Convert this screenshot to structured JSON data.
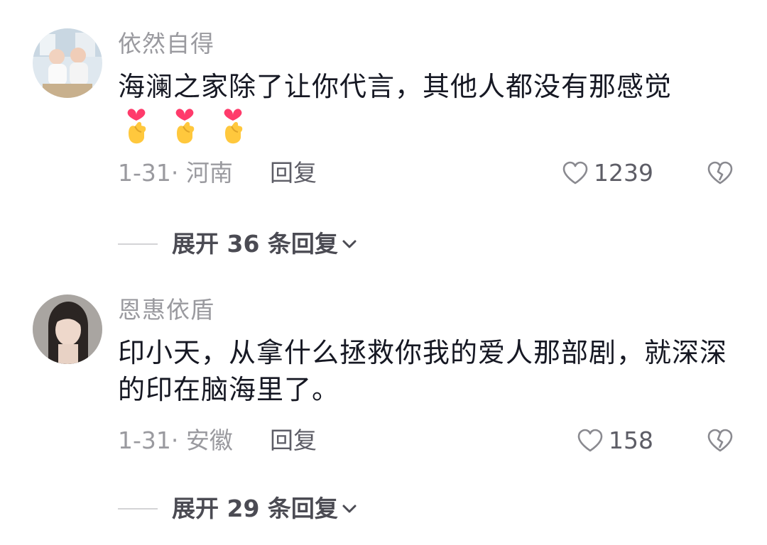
{
  "comments": [
    {
      "username": "依然自得",
      "text": "海澜之家除了让你代言，其他人都没有那感觉",
      "emoji_icon": "heart-hands-emoji",
      "emoji_count": 3,
      "date_location": "1-31· 河南",
      "reply_label": "回复",
      "likes": "1239",
      "expand_label": "展开 36 条回复"
    },
    {
      "username": "恩惠依盾",
      "text": "印小天，从拿什么拯救你我的爱人那部剧，就深深的印在脑海里了。",
      "date_location": "1-31· 安徽",
      "reply_label": "回复",
      "likes": "158",
      "expand_label": "展开 29 条回复"
    }
  ],
  "icons": {
    "like": "heart-outline-icon",
    "dislike": "broken-heart-icon",
    "expand": "chevron-down-icon"
  },
  "colors": {
    "text_primary": "#161823",
    "text_secondary": "#9a9a9f",
    "emoji_heart": "#ff3b6b",
    "emoji_hand": "#ffc83d"
  }
}
